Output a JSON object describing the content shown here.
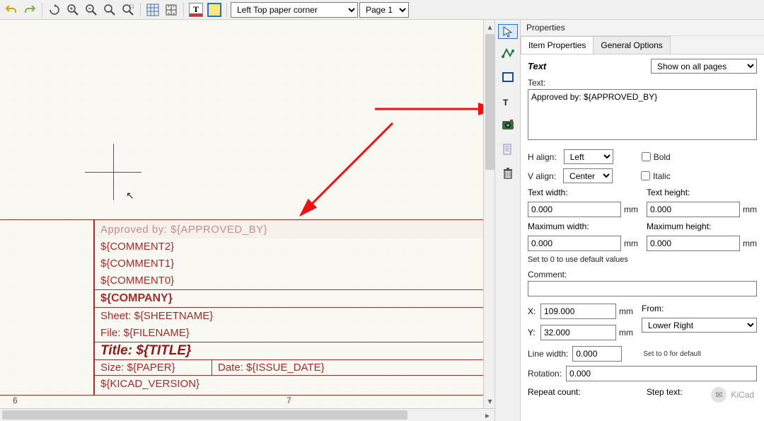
{
  "toolbar": {
    "origin_select": "Left Top paper corner",
    "page_select": "Page 1"
  },
  "canvas": {
    "title_block": {
      "approved_by": "Approved by: ${APPROVED_BY}",
      "comment2": "${COMMENT2}",
      "comment1": "${COMMENT1}",
      "comment0": "${COMMENT0}",
      "company": "${COMPANY}",
      "sheet": "Sheet: ${SHEETNAME}",
      "file": "File: ${FILENAME}",
      "title": "Title: ${TITLE}",
      "size": "Size: ${PAPER}",
      "date": "Date: ${ISSUE_DATE}",
      "kicad_version": "${KICAD_VERSION}"
    },
    "ruler": {
      "t6": "6",
      "t7": "7"
    }
  },
  "properties": {
    "panel_title": "Properties",
    "tab_item": "Item Properties",
    "tab_general": "General Options",
    "type_label": "Text",
    "show_mode": "Show on all pages",
    "text_label": "Text:",
    "text_value": "Approved by: ${APPROVED_BY}",
    "halign_label": "H align:",
    "halign_value": "Left",
    "valign_label": "V align:",
    "valign_value": "Center",
    "bold_label": "Bold",
    "italic_label": "Italic",
    "text_width_label": "Text width:",
    "text_width_value": "0.000",
    "text_height_label": "Text height:",
    "text_height_value": "0.000",
    "max_width_label": "Maximum width:",
    "max_width_value": "0.000",
    "max_height_label": "Maximum height:",
    "max_height_value": "0.000",
    "default_hint": "Set to 0 to use default values",
    "comment_label": "Comment:",
    "comment_value": "",
    "x_label": "X:",
    "x_value": "109.000",
    "y_label": "Y:",
    "y_value": "32.000",
    "from_label": "From:",
    "from_value": "Lower Right",
    "line_width_label": "Line width:",
    "line_width_value": "0.000",
    "line_width_hint": "Set to 0 for default",
    "rotation_label": "Rotation:",
    "rotation_value": "0.000",
    "repeat_label": "Repeat count:",
    "step_label": "Step text:",
    "unit_mm": "mm"
  },
  "watermark": "KiCad"
}
